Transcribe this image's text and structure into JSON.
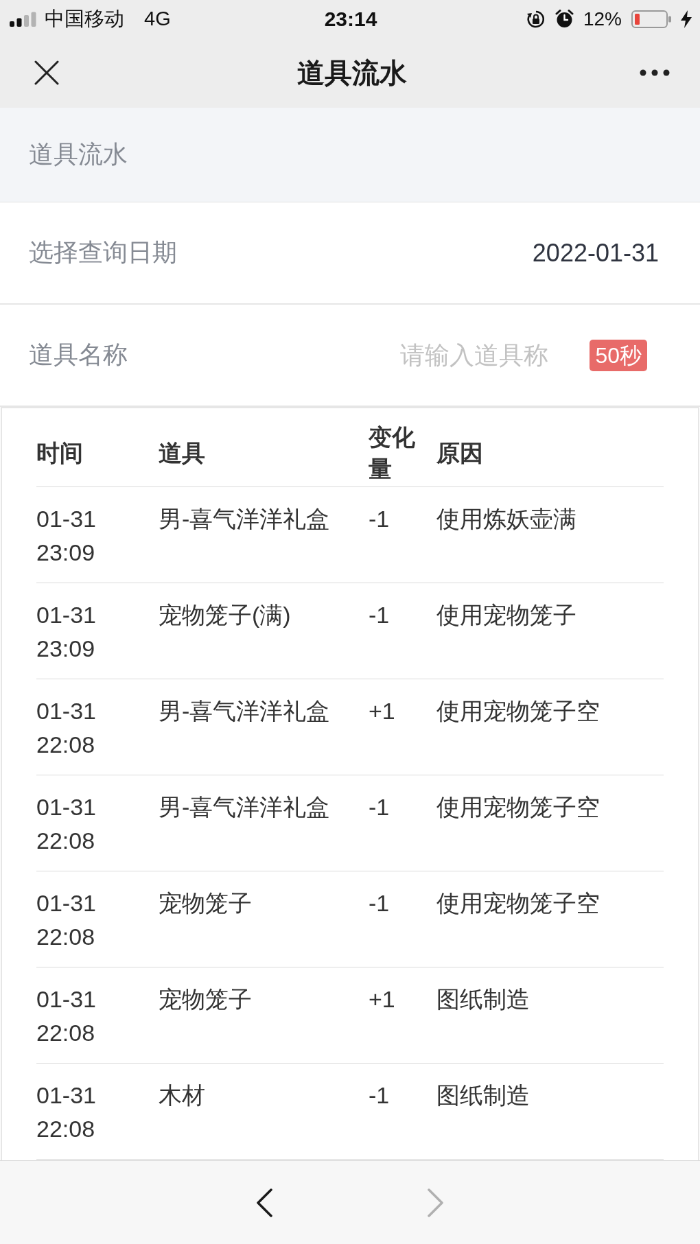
{
  "status_bar": {
    "carrier": "中国移动",
    "network": "4G",
    "time": "23:14",
    "battery_percent": "12%"
  },
  "nav_bar": {
    "title": "道具流水"
  },
  "section": {
    "title": "道具流水"
  },
  "form": [
    {
      "kind": "value",
      "label": "选择查询日期",
      "value": "2022-01-31"
    },
    {
      "kind": "input",
      "label": "道具名称",
      "placeholder": "请输入道具称",
      "badge": "50秒"
    }
  ],
  "table": {
    "columns": [
      "时间",
      "道具",
      "变化量",
      "原因"
    ],
    "rows": [
      [
        "01-31 23:09",
        "男-喜气洋洋礼盒",
        "-1",
        "使用炼妖壶满"
      ],
      [
        "01-31 23:09",
        "宠物笼子(满)",
        "-1",
        "使用宠物笼子"
      ],
      [
        "01-31 22:08",
        "男-喜气洋洋礼盒",
        "+1",
        "使用宠物笼子空"
      ],
      [
        "01-31 22:08",
        "男-喜气洋洋礼盒",
        "-1",
        "使用宠物笼子空"
      ],
      [
        "01-31 22:08",
        "宠物笼子",
        "-1",
        "使用宠物笼子空"
      ],
      [
        "01-31 22:08",
        "宠物笼子",
        "+1",
        "图纸制造"
      ],
      [
        "01-31 22:08",
        "木材",
        "-1",
        "图纸制造"
      ]
    ]
  },
  "browser_toolbar": {
    "back": {
      "disabled": false
    },
    "forward": {
      "disabled": true
    }
  }
}
